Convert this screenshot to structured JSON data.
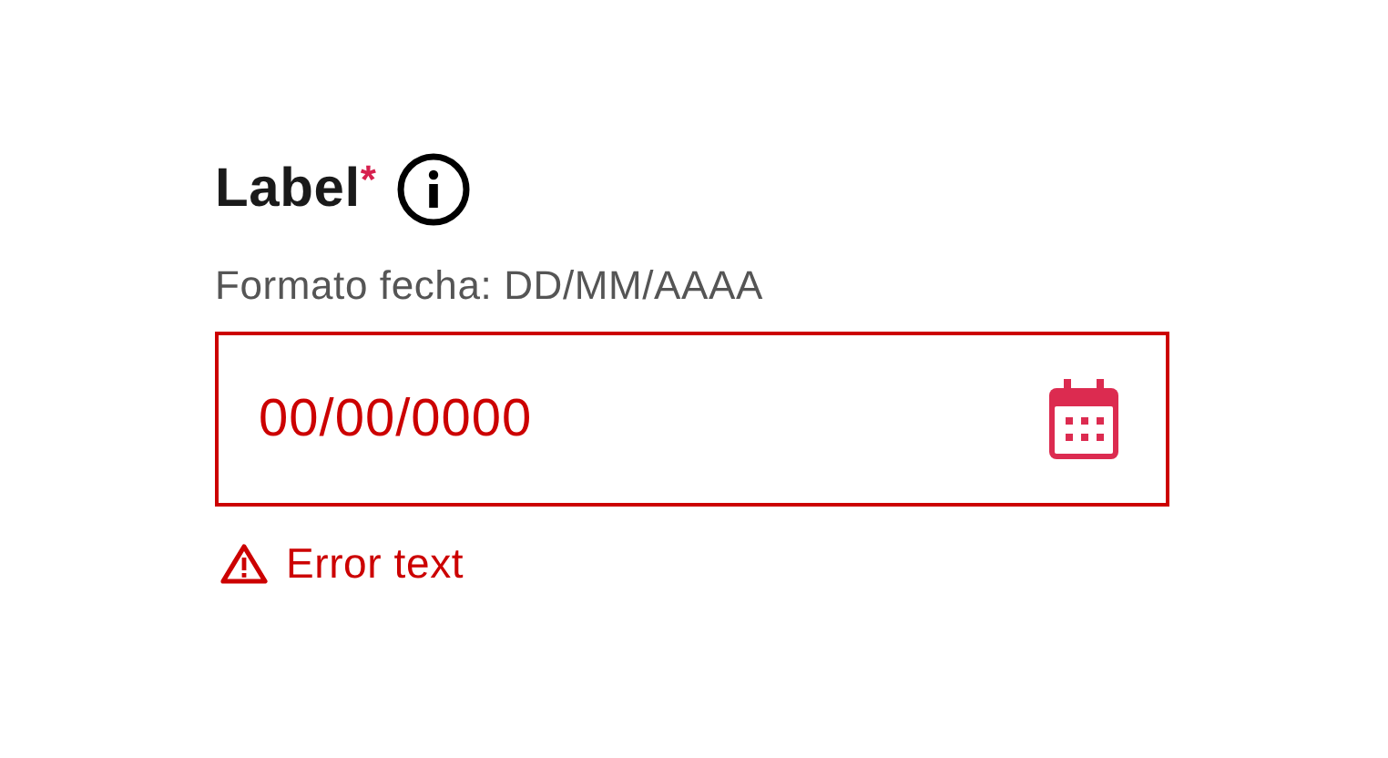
{
  "field": {
    "label": "Label",
    "required_mark": "*",
    "hint": "Formato fecha: DD/MM/AAAA",
    "value": "00/00/0000",
    "error": true,
    "error_text": "Error text"
  }
}
